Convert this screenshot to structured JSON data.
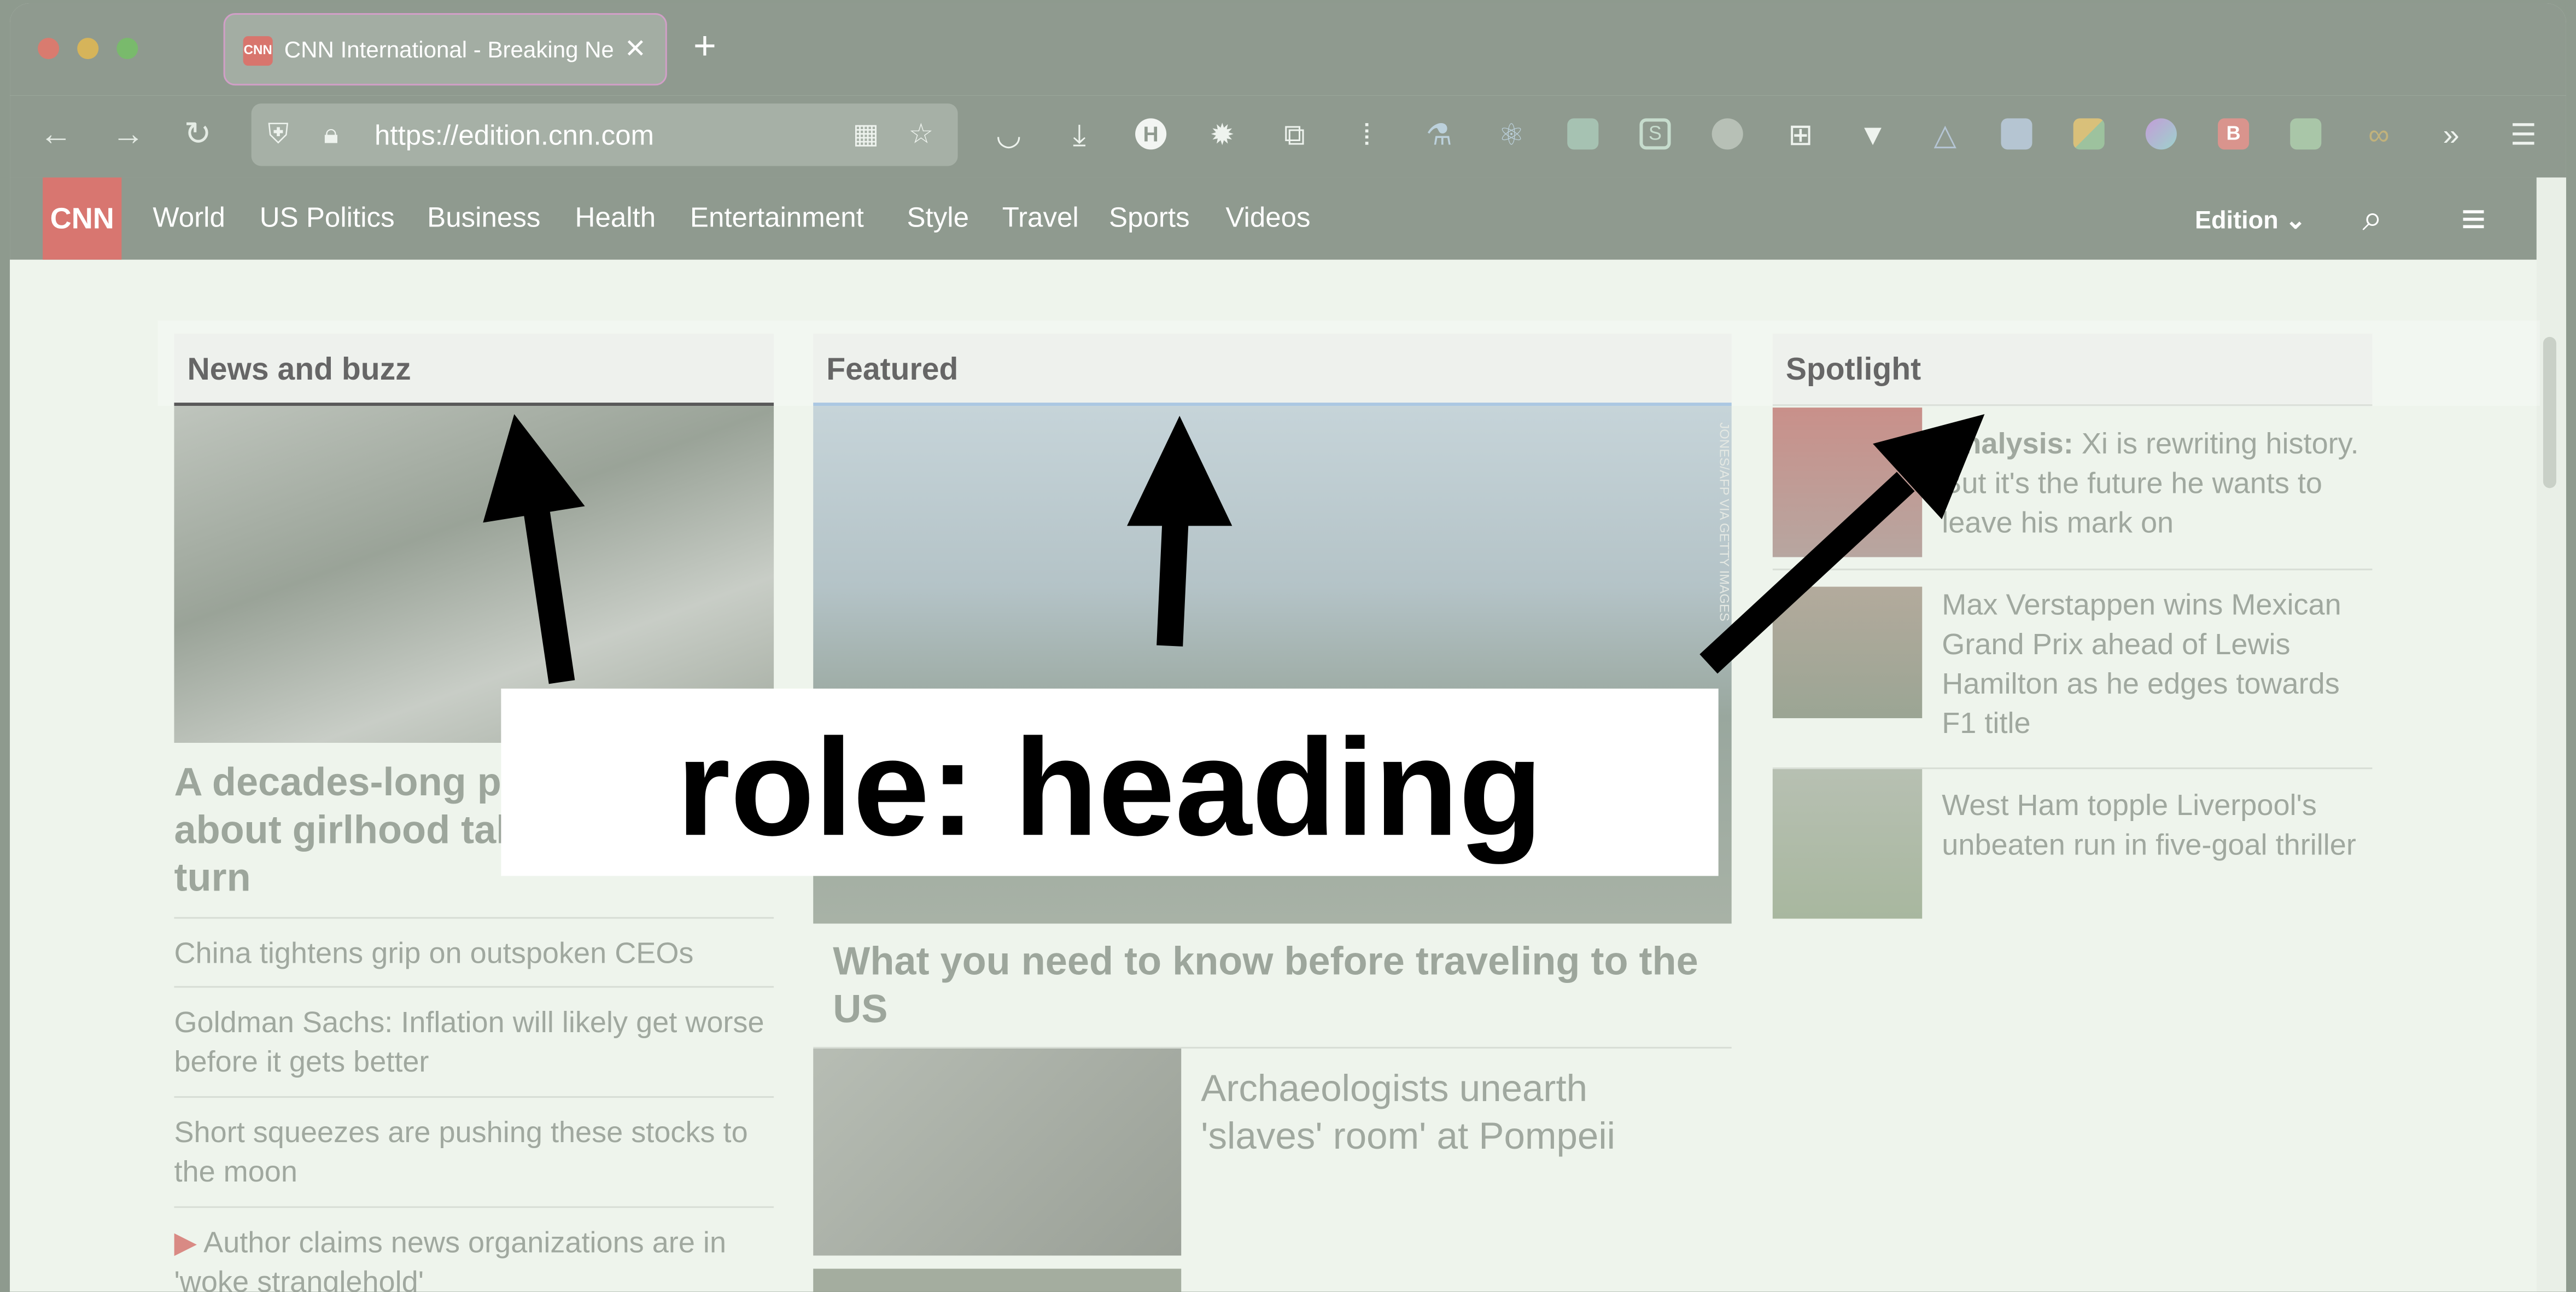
{
  "browser": {
    "tab_title": "CNN International - Breaking News",
    "tab_favicon": "CNN",
    "new_tab_icon": "+",
    "url": "https://edition.cnn.com",
    "toolbar_extension_letters": [
      "H",
      "S",
      "B"
    ]
  },
  "site": {
    "logo": "CNN",
    "nav": [
      "World",
      "US Politics",
      "Business",
      "Health",
      "Entertainment",
      "Style",
      "Travel",
      "Sports",
      "Videos"
    ],
    "edition_label": "Edition"
  },
  "sections": {
    "news": {
      "title": "News and buzz",
      "headline": "A decades-long photo series about girlhood takes a tragic turn",
      "items": [
        "China tightens grip on outspoken CEOs",
        "Goldman Sachs: Inflation will likely get worse before it gets better",
        "Short squeezes are pushing these stocks to the moon",
        "Author claims news organizations are in 'woke stranglehold'"
      ]
    },
    "featured": {
      "title": "Featured",
      "photo_credit": "JONES/AFP VIA GETTY IMAGES",
      "headline": "What you need to know before traveling to the US",
      "sub_headline": "Archaeologists unearth 'slaves' room' at Pompeii"
    },
    "spotlight": {
      "title": "Spotlight",
      "items": [
        {
          "label": "Analysis:",
          "text": "Xi is rewriting history. But it's the future he wants to leave his mark on"
        },
        {
          "label": "",
          "text": "Max Verstappen wins Mexican Grand Prix ahead of Lewis Hamilton as he edges towards F1 title"
        },
        {
          "label": "",
          "text": "West Ham topple Liverpool's unbeaten run in five-goal thriller"
        }
      ]
    }
  },
  "annotation": {
    "label": "role: heading"
  }
}
